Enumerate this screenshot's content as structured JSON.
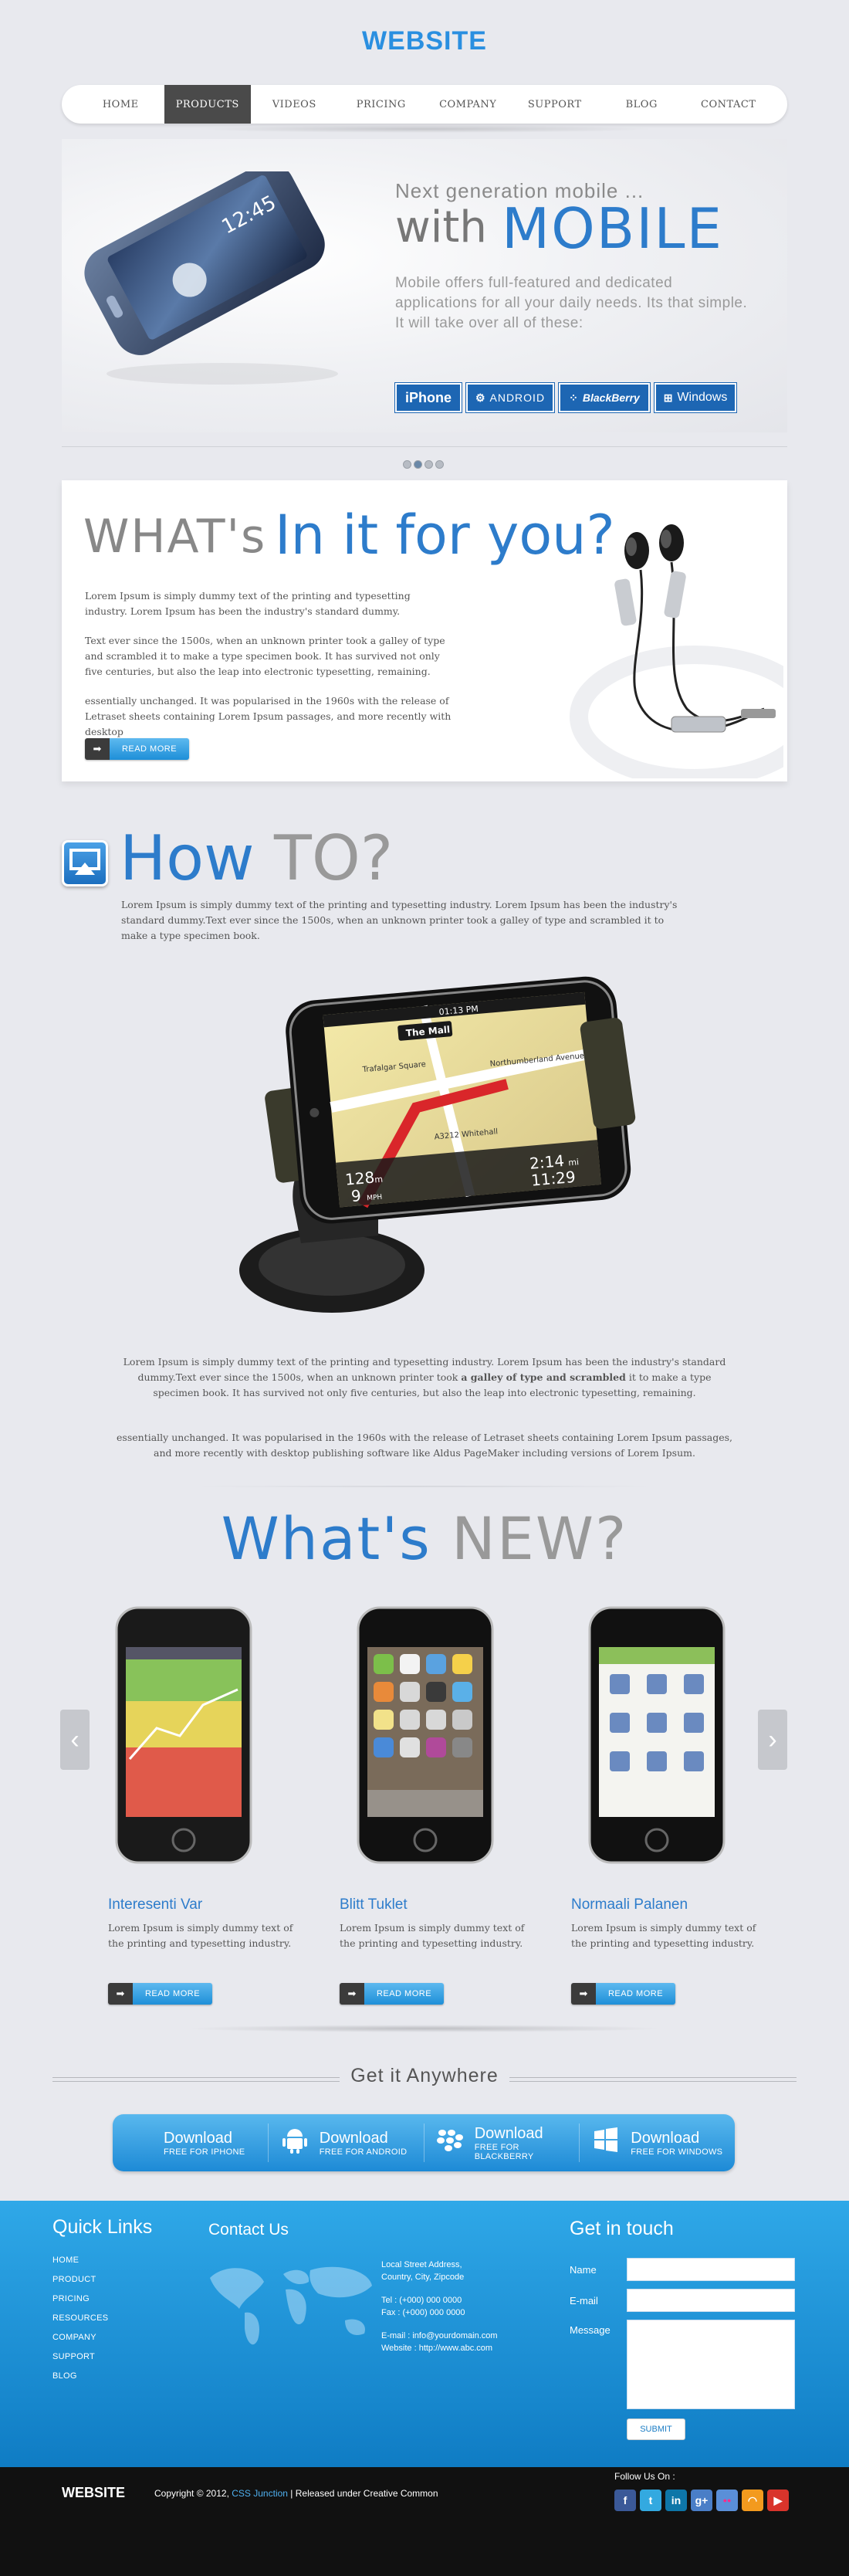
{
  "header": {
    "logo": "WEBSITE",
    "nav": [
      "HOME",
      "PRODUCTS",
      "VIDEOS",
      "PRICING",
      "COMPANY",
      "SUPPORT",
      "BLOG",
      "CONTACT"
    ],
    "active_nav": "PRODUCTS"
  },
  "hero": {
    "subtitle": "Next generation mobile ...",
    "with": "with",
    "mobile": "MOBILE",
    "description": "Mobile offers full-featured and dedicated applications for all your daily needs. Its that simple. It will take over all of these:",
    "platforms": [
      {
        "name": "iPhone",
        "icon": "apple-icon"
      },
      {
        "name": "ANDROID",
        "icon": "android-icon"
      },
      {
        "name": "BlackBerry",
        "icon": "blackberry-icon"
      },
      {
        "name": "Windows",
        "icon": "windows-icon"
      }
    ],
    "phone_clock": "12:45",
    "slider_dots": 4,
    "active_dot": 1
  },
  "whats_in": {
    "heading_1": "WHAT's",
    "heading_2": "In it for you?",
    "paragraphs": [
      "Lorem Ipsum is simply dummy text of the printing and typesetting industry. Lorem Ipsum has been the industry's standard dummy.",
      "Text ever since the 1500s, when an unknown printer took a galley of type and scrambled it to make a type specimen book. It has survived not only five centuries, but also the leap into electronic typesetting, remaining.",
      "essentially unchanged. It was popularised in the 1960s with the release of Letraset sheets containing Lorem Ipsum passages, and more recently with desktop"
    ],
    "read_more": "READ MORE"
  },
  "how_to": {
    "heading_1": "How",
    "heading_2": "TO?",
    "intro": "Lorem Ipsum is simply dummy text of the printing and typesetting industry. Lorem Ipsum has been the industry's standard dummy.Text ever since the 1500s, when an unknown printer took a galley of type and scrambled it to make a type specimen book.",
    "para_2a": "Lorem Ipsum is simply dummy text of the printing and typesetting industry. Lorem Ipsum has been the industry's standard dummy.Text ever since the 1500s, when an unknown printer took ",
    "para_2b": "a galley of type and scrambled",
    "para_2c": " it to make a type specimen book. It has survived not only five centuries, but also the leap into electronic typesetting, remaining.",
    "para_3": "essentially unchanged. It was popularised in the 1960s with the release of Letraset sheets containing Lorem Ipsum passages, and more recently with desktop publishing software like Aldus PageMaker including versions of Lorem Ipsum.",
    "gps": {
      "time": "01:13 PM",
      "street": "The Mall",
      "road_1": "Trafalgar Square",
      "road_2": "Northumberland Avenue",
      "road_3": "A3212 Whitehall",
      "distance": "128",
      "distance_unit": "m",
      "speed": "9",
      "speed_unit": "MPH",
      "remaining": "2:14",
      "remaining_unit": "mi",
      "eta": "11:29"
    }
  },
  "whats_new": {
    "heading_1": "What's",
    "heading_2": "NEW?",
    "products": [
      {
        "title": "Interesenti Var",
        "desc": "Lorem Ipsum is simply dummy text of the printing and typesetting industry.",
        "read_more": "READ MORE"
      },
      {
        "title": "Blitt Tuklet",
        "desc": "Lorem Ipsum is simply dummy text of the printing and typesetting industry.",
        "read_more": "READ MORE"
      },
      {
        "title": "Normaali Palanen",
        "desc": "Lorem Ipsum is simply dummy text of the printing and typesetting industry.",
        "read_more": "READ MORE"
      }
    ]
  },
  "get_it": {
    "heading": "Get it Anywhere",
    "downloads": [
      {
        "label": "Download",
        "sub": "FREE FOR IPHONE",
        "icon": "apple-icon"
      },
      {
        "label": "Download",
        "sub": "FREE FOR ANDROID",
        "icon": "android-icon"
      },
      {
        "label": "Download",
        "sub": "FREE FOR BLACKBERRY",
        "icon": "blackberry-icon"
      },
      {
        "label": "Download",
        "sub": "FREE FOR WINDOWS",
        "icon": "windows-icon"
      }
    ]
  },
  "footer": {
    "quick_links_title": "Quick Links",
    "quick_links": [
      "HOME",
      "PRODUCT",
      "PRICING",
      "RESOURCES",
      "COMPANY",
      "SUPPORT",
      "BLOG"
    ],
    "contact_title": "Contact Us",
    "address_1": "Local Street Address,",
    "address_2": "Country, City, Zipcode",
    "tel": "Tel : (+000) 000 0000",
    "fax": "Fax : (+000) 000 0000",
    "email": "E-mail : info@yourdomain.com",
    "website": "Website : http://www.abc.com",
    "touch_title": "Get in touch",
    "name_label": "Name",
    "email_label": "E-mail",
    "message_label": "Message",
    "submit": "SUBMIT"
  },
  "bottom": {
    "logo": "WEBSITE",
    "copy_1": "Copyright © 2012,",
    "copy_link": "CSS Junction",
    "copy_2": "| Released under Creative Common",
    "follow": "Follow Us On :",
    "social": [
      {
        "icon": "facebook-icon",
        "glyph": "f",
        "color": "#3b5998"
      },
      {
        "icon": "twitter-icon",
        "glyph": "t",
        "color": "#33a9e0"
      },
      {
        "icon": "linkedin-icon",
        "glyph": "in",
        "color": "#0e76a8"
      },
      {
        "icon": "google-plus-icon",
        "glyph": "g+",
        "color": "#4a7ec7"
      },
      {
        "icon": "flickr-icon",
        "glyph": "●●",
        "color": "#5a8fd8"
      },
      {
        "icon": "rss-icon",
        "glyph": "◠",
        "color": "#f39a1e"
      },
      {
        "icon": "youtube-icon",
        "glyph": "▶",
        "color": "#d9342b"
      }
    ]
  }
}
